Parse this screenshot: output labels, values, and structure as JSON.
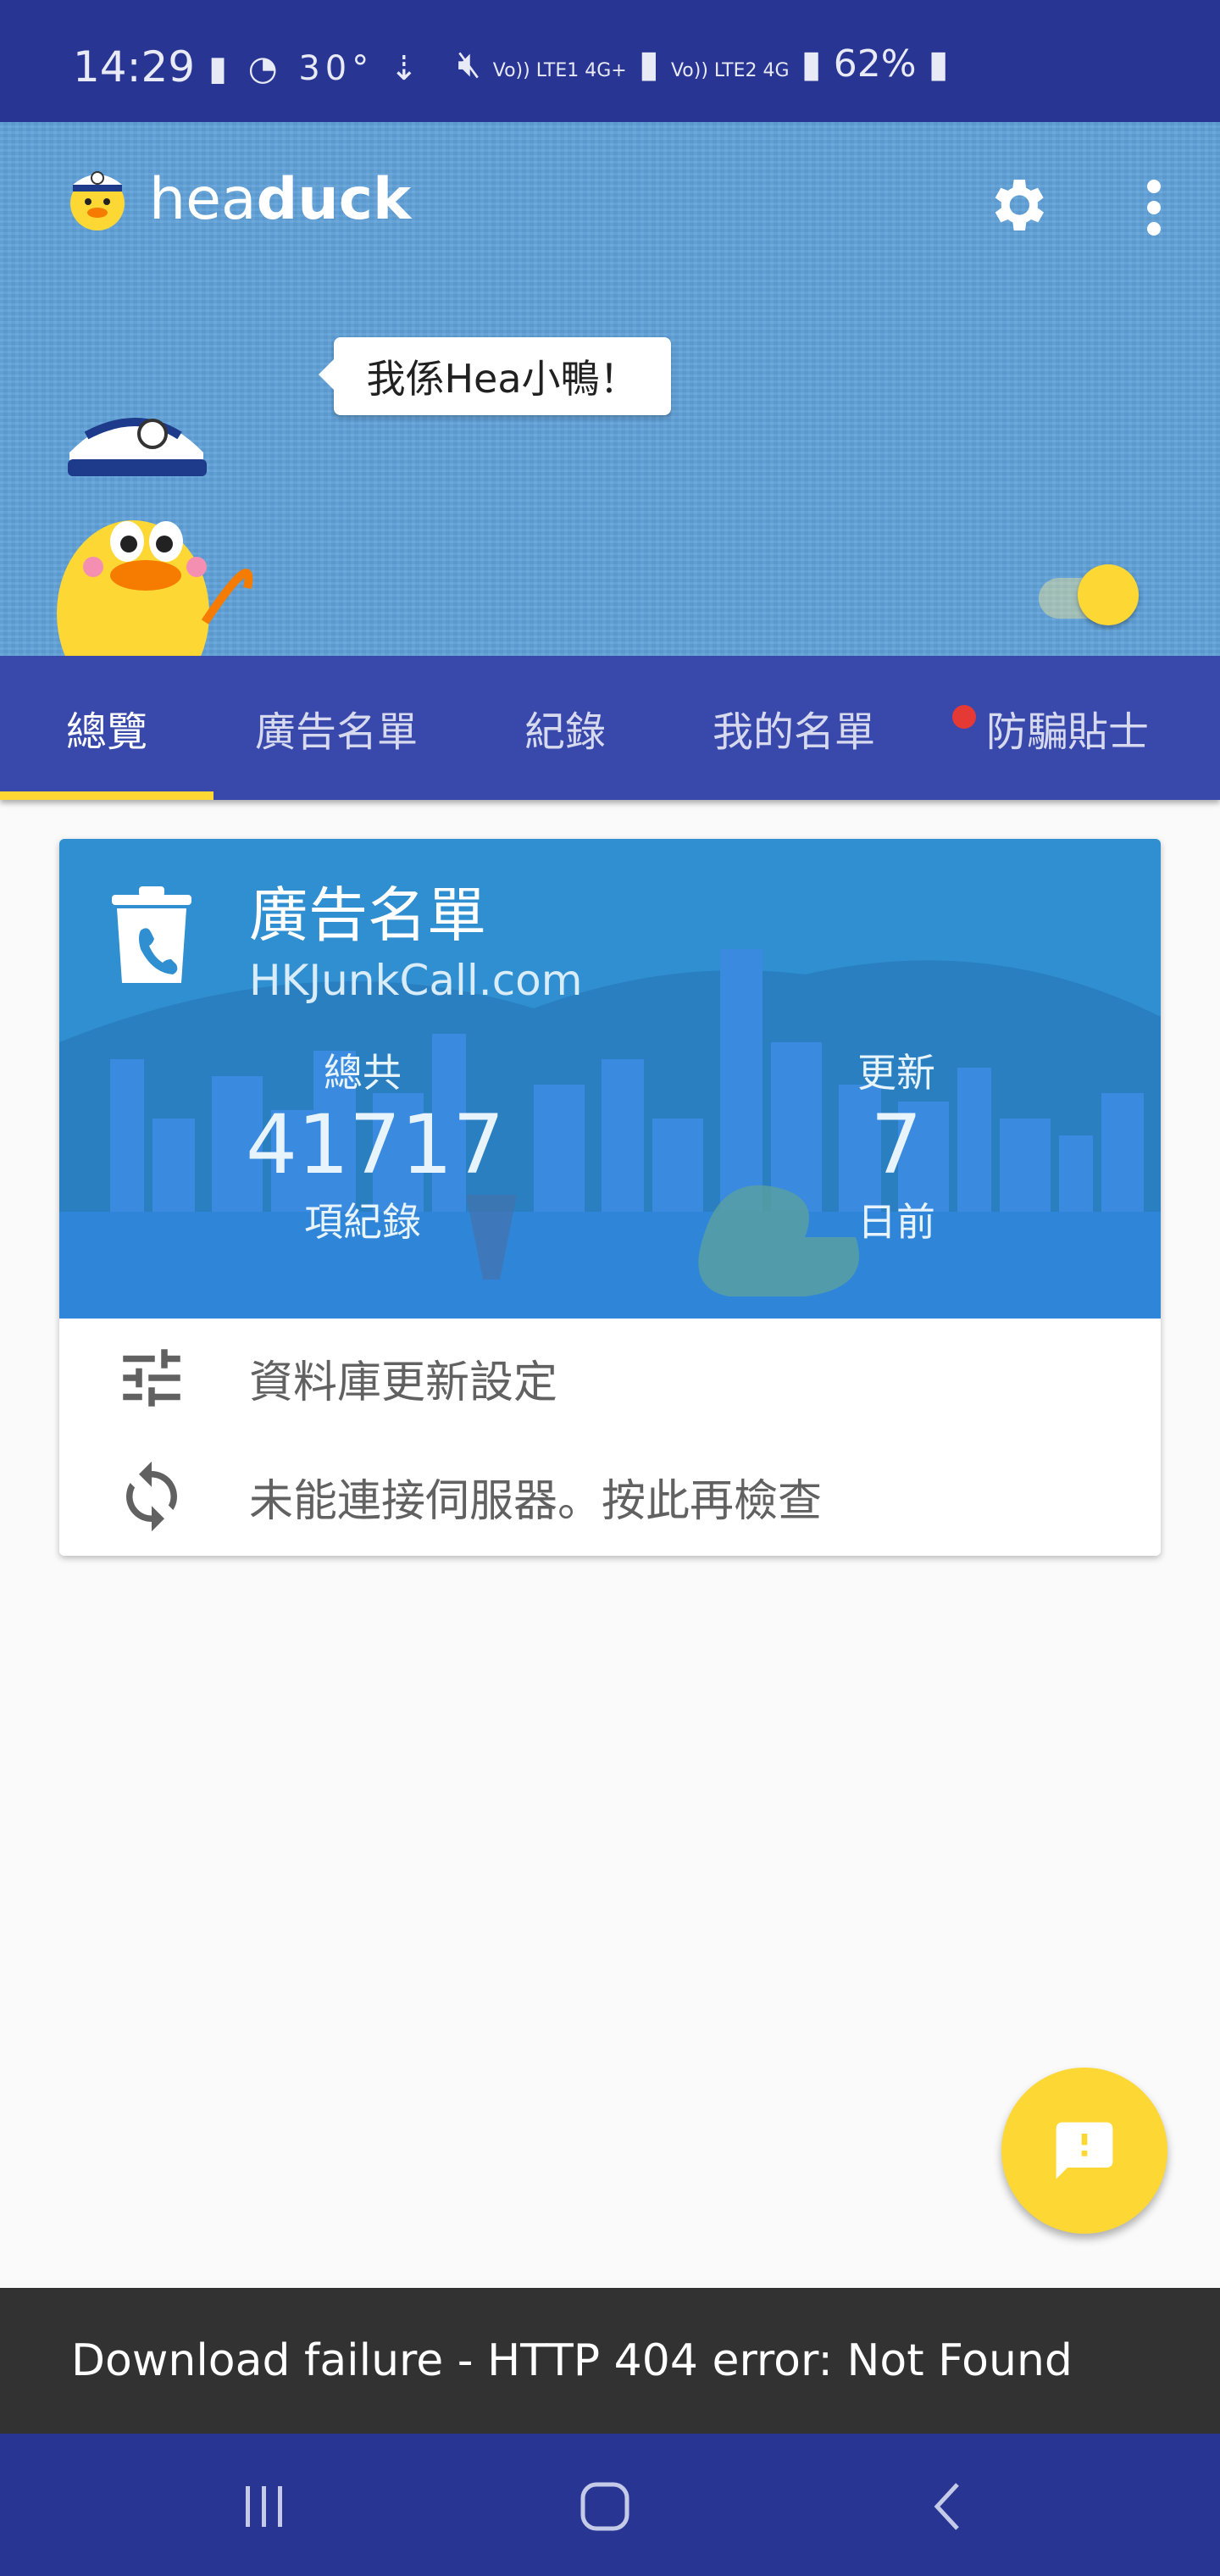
{
  "status_bar": {
    "time": "14:29",
    "temperature": "30°",
    "network_1": "Vo)) LTE1 4G+",
    "network_2": "Vo)) LTE2 4G",
    "battery": "62%"
  },
  "header": {
    "app_name_light": "hea",
    "app_name_bold": "duck",
    "speech_bubble": "我係Hea小鴨！",
    "toggle_on": true
  },
  "tabs": [
    {
      "label": "總覽",
      "active": true
    },
    {
      "label": "廣告名單",
      "active": false
    },
    {
      "label": "紀錄",
      "active": false
    },
    {
      "label": "我的名單",
      "active": false
    },
    {
      "label": "防騙貼士",
      "active": false,
      "badge": true
    }
  ],
  "card": {
    "title": "廣告名單",
    "subtitle": "HKJunkCall.com",
    "total_label": "總共",
    "total_value": "41717",
    "total_unit": "項紀錄",
    "update_label": "更新",
    "update_value": "7",
    "update_unit": "日前",
    "rows": [
      {
        "label": "資料庫更新設定",
        "icon": "tune-icon"
      },
      {
        "label": "未能連接伺服器。按此再檢查",
        "icon": "sync-icon"
      }
    ]
  },
  "snackbar": {
    "message": "Download failure - HTTP 404 error: Not Found"
  },
  "colors": {
    "status_bar": "#283593",
    "header_bg": "#5fa0d8",
    "tabs_bg": "#3949ab",
    "accent_yellow": "#fdd835",
    "card_banner": "#2f8fd0",
    "snackbar": "#323232"
  }
}
